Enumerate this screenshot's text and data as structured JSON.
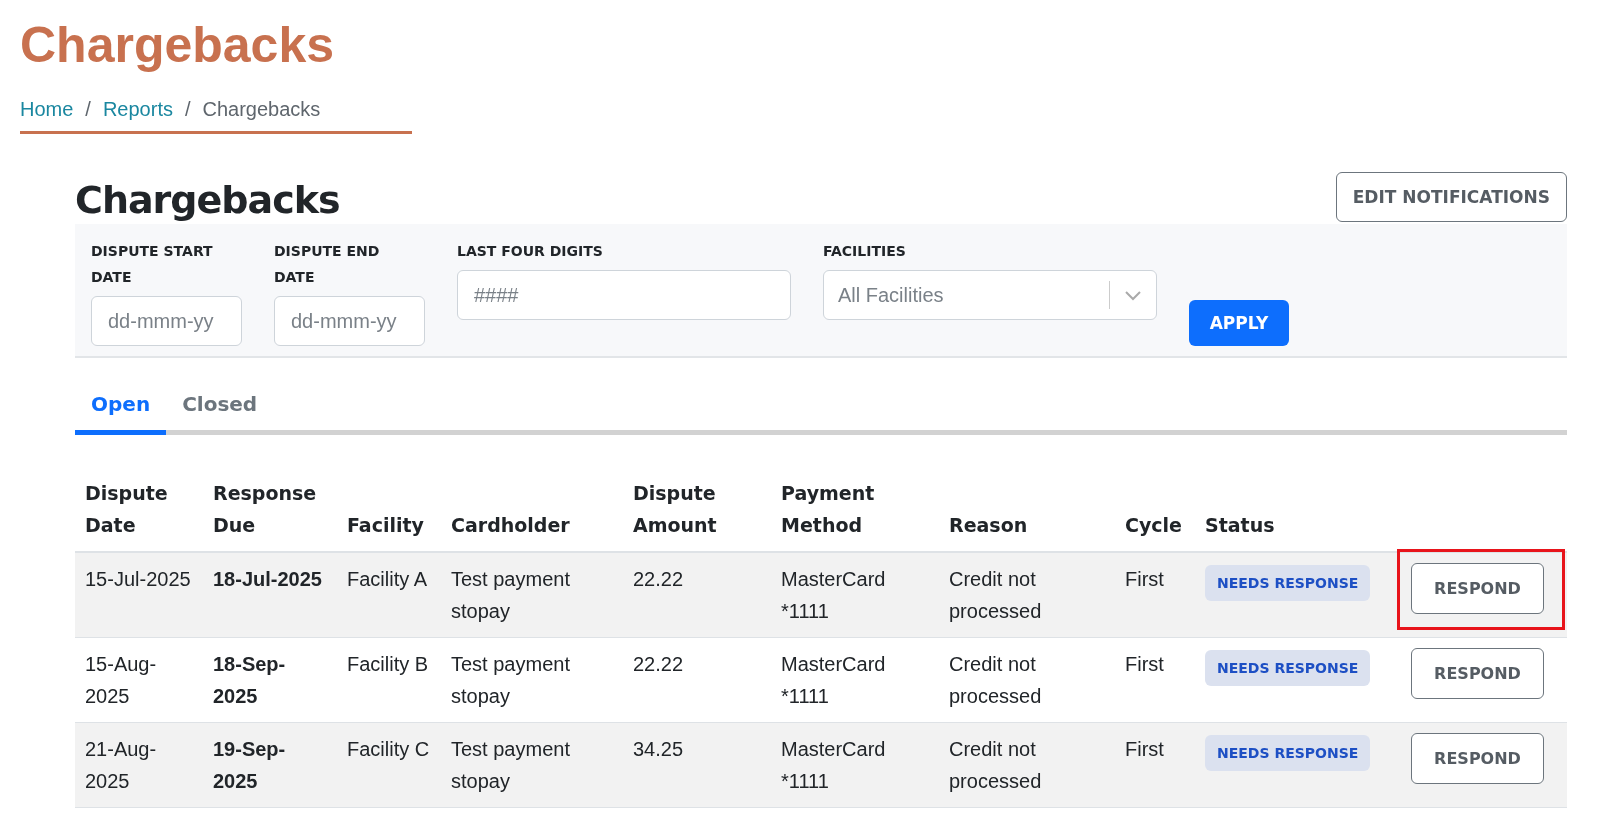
{
  "page_title": "Chargebacks",
  "breadcrumb": [
    {
      "label": "Home",
      "kind": "link"
    },
    {
      "label": "/",
      "kind": "separator"
    },
    {
      "label": "Reports",
      "kind": "link"
    },
    {
      "label": "/",
      "kind": "separator"
    },
    {
      "label": "Chargebacks",
      "kind": "current"
    }
  ],
  "heading": "Chargebacks",
  "edit_button": "EDIT NOTIFICATIONS",
  "filters": [
    {
      "kind": "date",
      "label": "DISPUTE START DATE",
      "placeholder": "dd-mmm-yy"
    },
    {
      "kind": "date",
      "label": "DISPUTE END DATE",
      "placeholder": "dd-mmm-yy"
    },
    {
      "kind": "text",
      "label": "LAST FOUR DIGITS",
      "placeholder": "####"
    },
    {
      "kind": "select",
      "label": "FACILITIES",
      "placeholder": "All Facilities"
    }
  ],
  "apply_button": "APPLY",
  "tabs": [
    {
      "label": "Open",
      "selected": true
    },
    {
      "label": "Closed",
      "selected": false
    }
  ],
  "table": {
    "columns": [
      "Dispute Date",
      "Response Due",
      "Facility",
      "Cardholder",
      "Dispute Amount",
      "Payment Method",
      "Reason",
      "Cycle",
      "Status"
    ],
    "rows": [
      {
        "cells": [
          "15-Jul-2025",
          "18-Jul-2025",
          "Facility A",
          "Test payment stopay",
          "22.22",
          "MasterCard *1111",
          "Credit not processed",
          "First"
        ],
        "status": "NEEDS RESPONSE",
        "action": "RESPOND",
        "highlighted": true
      },
      {
        "cells": [
          "15-Aug-2025",
          "18-Sep-2025",
          "Facility B",
          "Test payment stopay",
          "22.22",
          "MasterCard *1111",
          "Credit not processed",
          "First"
        ],
        "status": "NEEDS RESPONSE",
        "action": "RESPOND",
        "highlighted": false
      },
      {
        "cells": [
          "21-Aug-2025",
          "19-Sep-2025",
          "Facility C",
          "Test payment stopay",
          "34.25",
          "MasterCard *1111",
          "Credit not processed",
          "First"
        ],
        "status": "NEEDS RESPONSE",
        "action": "RESPOND",
        "highlighted": false
      }
    ]
  }
}
